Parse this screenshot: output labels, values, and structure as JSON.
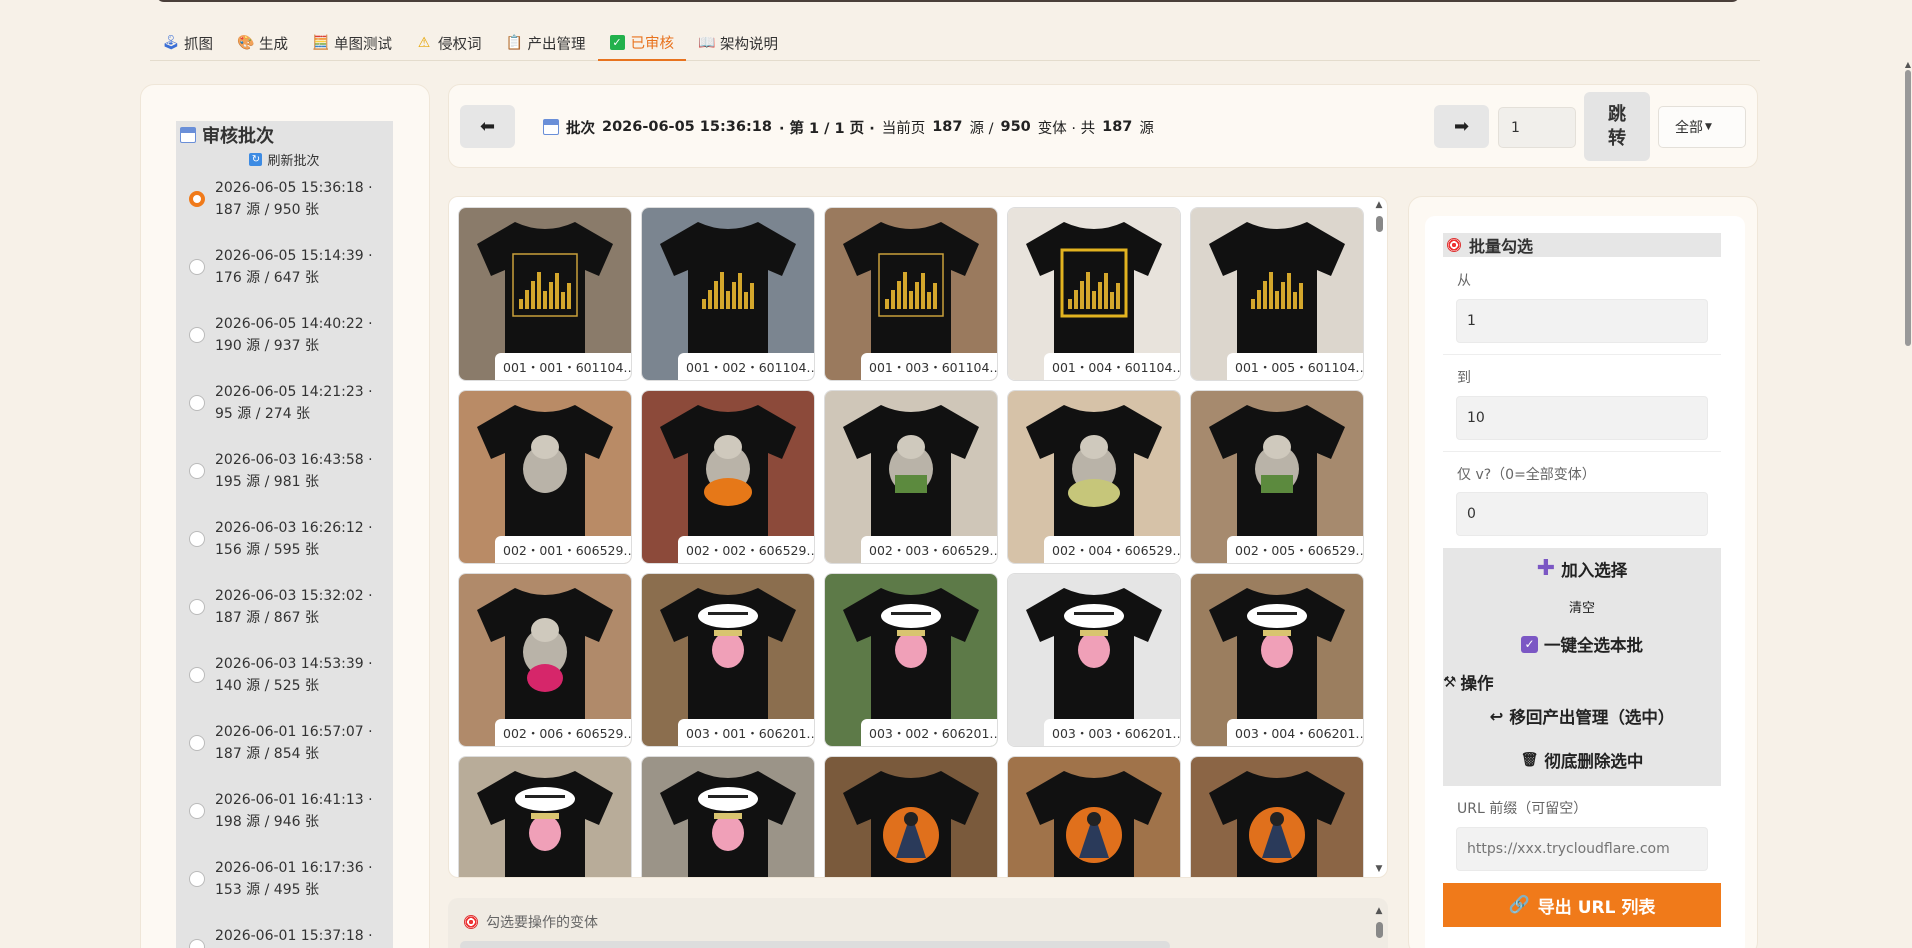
{
  "tabs": [
    {
      "label": "抓图",
      "icon": "joystick-icon",
      "active": false
    },
    {
      "label": "生成",
      "icon": "palette-icon",
      "active": false
    },
    {
      "label": "单图测试",
      "icon": "abacus-icon",
      "active": false
    },
    {
      "label": "侵权词",
      "icon": "warning-icon",
      "active": false
    },
    {
      "label": "产出管理",
      "icon": "clipboard-icon",
      "active": false
    },
    {
      "label": "已审核",
      "icon": "check-box-icon",
      "active": true
    },
    {
      "label": "架构说明",
      "icon": "book-icon",
      "active": false
    }
  ],
  "sidebar": {
    "title": "审核批次",
    "refresh_label": "刷新批次",
    "batches": [
      {
        "line1": "2026-06-05 15:36:18 ·",
        "line2": "187 源 / 950 张",
        "selected": true
      },
      {
        "line1": "2026-06-05 15:14:39 ·",
        "line2": "176 源 / 647 张",
        "selected": false
      },
      {
        "line1": "2026-06-05 14:40:22 ·",
        "line2": "190 源 / 937 张",
        "selected": false
      },
      {
        "line1": "2026-06-05 14:21:23 ·",
        "line2": "95 源 / 274 张",
        "selected": false
      },
      {
        "line1": "2026-06-03 16:43:58 ·",
        "line2": "195 源 / 981 张",
        "selected": false
      },
      {
        "line1": "2026-06-03 16:26:12 ·",
        "line2": "156 源 / 595 张",
        "selected": false
      },
      {
        "line1": "2026-06-03 15:32:02 ·",
        "line2": "187 源 / 867 张",
        "selected": false
      },
      {
        "line1": "2026-06-03 14:53:39 ·",
        "line2": "140 源 / 525 张",
        "selected": false
      },
      {
        "line1": "2026-06-01 16:57:07 ·",
        "line2": "187 源 / 854 张",
        "selected": false
      },
      {
        "line1": "2026-06-01 16:41:13 ·",
        "line2": "198 源 / 946 张",
        "selected": false
      },
      {
        "line1": "2026-06-01 16:17:36 ·",
        "line2": "153 源 / 495 张",
        "selected": false
      },
      {
        "line1": "2026-06-01 15:37:18 ·",
        "line2": "",
        "selected": false
      }
    ]
  },
  "header": {
    "prev_label": "⬅",
    "next_label": "➡",
    "info_prefix": "批次",
    "info_datetime": "2026-06-05 15:36:18",
    "info_page": "· 第 1 / 1 页 ·",
    "info_current": "当前页",
    "info_current_count": "187",
    "info_current_unit": "源 /",
    "info_variants": "950",
    "info_variants_unit": "变体 · 共",
    "info_total": "187",
    "info_total_unit": "源",
    "page_input_value": "1",
    "jump_label_1": "跳",
    "jump_label_2": "转",
    "filter_value": "全部"
  },
  "gallery": {
    "items": [
      {
        "caption": "001・001・601104…",
        "bg": "#8a7b6a",
        "art": "gold-city"
      },
      {
        "caption": "001・002・601104…",
        "bg": "#7b8590",
        "art": "gold-line"
      },
      {
        "caption": "001・003・601104…",
        "bg": "#9a7a5e",
        "art": "gold-frame"
      },
      {
        "caption": "001・004・601104…",
        "bg": "#e8e3dc",
        "art": "gold-box"
      },
      {
        "caption": "001・005・601104…",
        "bg": "#dcd6cd",
        "art": "gold-line"
      },
      {
        "caption": "002・001・606529…",
        "bg": "#b98b66",
        "art": "cat"
      },
      {
        "caption": "002・002・606529…",
        "bg": "#8c4a3a",
        "art": "cat-pumpkin"
      },
      {
        "caption": "002・003・606529…",
        "bg": "#cfc6b8",
        "art": "cat-green"
      },
      {
        "caption": "002・004・606529…",
        "bg": "#d6c2a8",
        "art": "cat-melon"
      },
      {
        "caption": "002・005・606529…",
        "bg": "#a68a6e",
        "art": "cat-green"
      },
      {
        "caption": "002・006・606529…",
        "bg": "#b08a6a",
        "art": "cat-fruit"
      },
      {
        "caption": "003・001・606201…",
        "bg": "#8b6e4e",
        "art": "pig"
      },
      {
        "caption": "003・002・606201…",
        "bg": "#5d7a48",
        "art": "pig"
      },
      {
        "caption": "003・003・606201…",
        "bg": "#e5e5e5",
        "art": "pig"
      },
      {
        "caption": "003・004・606201…",
        "bg": "#9b7e5f",
        "art": "pig"
      },
      {
        "caption": "",
        "bg": "#b8ac99",
        "art": "pig"
      },
      {
        "caption": "",
        "bg": "#9b9488",
        "art": "pig"
      },
      {
        "caption": "",
        "bg": "#7a5a3c",
        "art": "reaper"
      },
      {
        "caption": "",
        "bg": "#a0734a",
        "art": "reaper"
      },
      {
        "caption": "",
        "bg": "#8b6545",
        "art": "reaper"
      }
    ]
  },
  "bottom": {
    "label": "勾选要操作的变体"
  },
  "batch_select": {
    "title": "批量勾选",
    "from_label": "从",
    "from_value": "1",
    "to_label": "到",
    "to_value": "10",
    "only_label": "仅 v?（0=全部变体）",
    "only_value": "0",
    "add_label": "加入选择",
    "clear_label": "清空",
    "select_all_label": "一键全选本批",
    "ops_label": "操作",
    "move_back_label": "移回产出管理（选中）",
    "delete_label": "彻底删除选中",
    "url_label": "URL 前缀（可留空）",
    "url_placeholder": "https://xxx.trycloudflare.com",
    "export_label": "导出 URL 列表"
  }
}
